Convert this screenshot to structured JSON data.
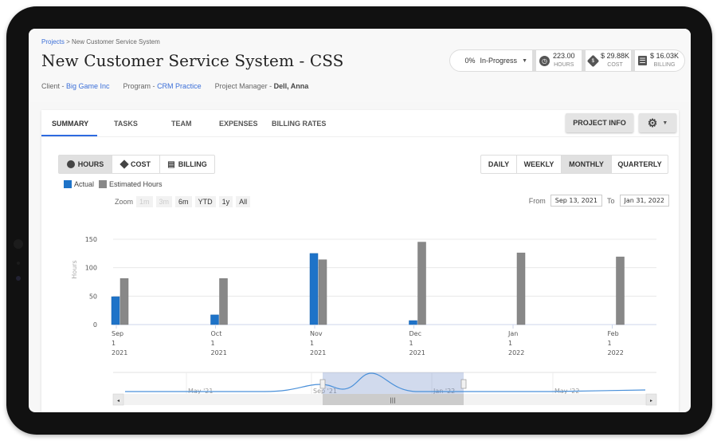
{
  "breadcrumb": {
    "parent": "Projects",
    "separator": " > ",
    "current": "New Customer Service System"
  },
  "title": "New Customer Service System - CSS",
  "meta": {
    "client_label": "Client - ",
    "client": "Big Game Inc",
    "program_label": "Program - ",
    "program": "CRM Practice",
    "manager_label": "Project Manager - ",
    "manager": "Dell, Anna"
  },
  "stats": {
    "progress": "0%",
    "status": "In-Progress",
    "hours_value": "223.00",
    "hours_label": "HOURS",
    "cost_value": "$ 29.88K",
    "cost_label": "COST",
    "billing_value": "$ 16.03K",
    "billing_label": "BILLING"
  },
  "tabs": [
    {
      "label": "SUMMARY",
      "active": true
    },
    {
      "label": "TASKS"
    },
    {
      "label": "TEAM"
    },
    {
      "label": "EXPENSES"
    },
    {
      "label": "BILLING RATES"
    }
  ],
  "buttons": {
    "project_info": "PROJECT INFO"
  },
  "metric_toggle": [
    "HOURS",
    "COST",
    "BILLING"
  ],
  "period_toggle": [
    "DAILY",
    "WEEKLY",
    "MONTHLY",
    "QUARTERLY"
  ],
  "legend": {
    "actual": "Actual",
    "estimated": "Estimated Hours"
  },
  "zoom": {
    "label": "Zoom",
    "options": [
      "1m",
      "3m",
      "6m",
      "YTD",
      "1y",
      "All"
    ]
  },
  "range": {
    "from_label": "From",
    "from": "Sep 13, 2021",
    "to_label": "To",
    "to": "Jan 31, 2022"
  },
  "colors": {
    "actual": "#1e73c8",
    "estimated": "#888888",
    "accent": "#2d6ae0"
  },
  "chart_data": {
    "type": "bar",
    "ylabel": "Hours",
    "ylim": [
      0,
      150
    ],
    "yticks": [
      0,
      50,
      100,
      150
    ],
    "categories": [
      [
        "Sep",
        "1",
        "2021"
      ],
      [
        "Oct",
        "1",
        "2021"
      ],
      [
        "Nov",
        "1",
        "2021"
      ],
      [
        "Dec",
        "1",
        "2021"
      ],
      [
        "Jan",
        "1",
        "2022"
      ],
      [
        "Feb",
        "1",
        "2022"
      ]
    ],
    "series": [
      {
        "name": "Actual",
        "values": [
          49,
          17,
          125,
          7,
          0,
          0
        ]
      },
      {
        "name": "Estimated Hours",
        "values": [
          81,
          81,
          114,
          145,
          126,
          119
        ]
      }
    ],
    "navigator_labels": [
      "May '21",
      "Sep '21",
      "Jan '22",
      "May '22"
    ]
  }
}
